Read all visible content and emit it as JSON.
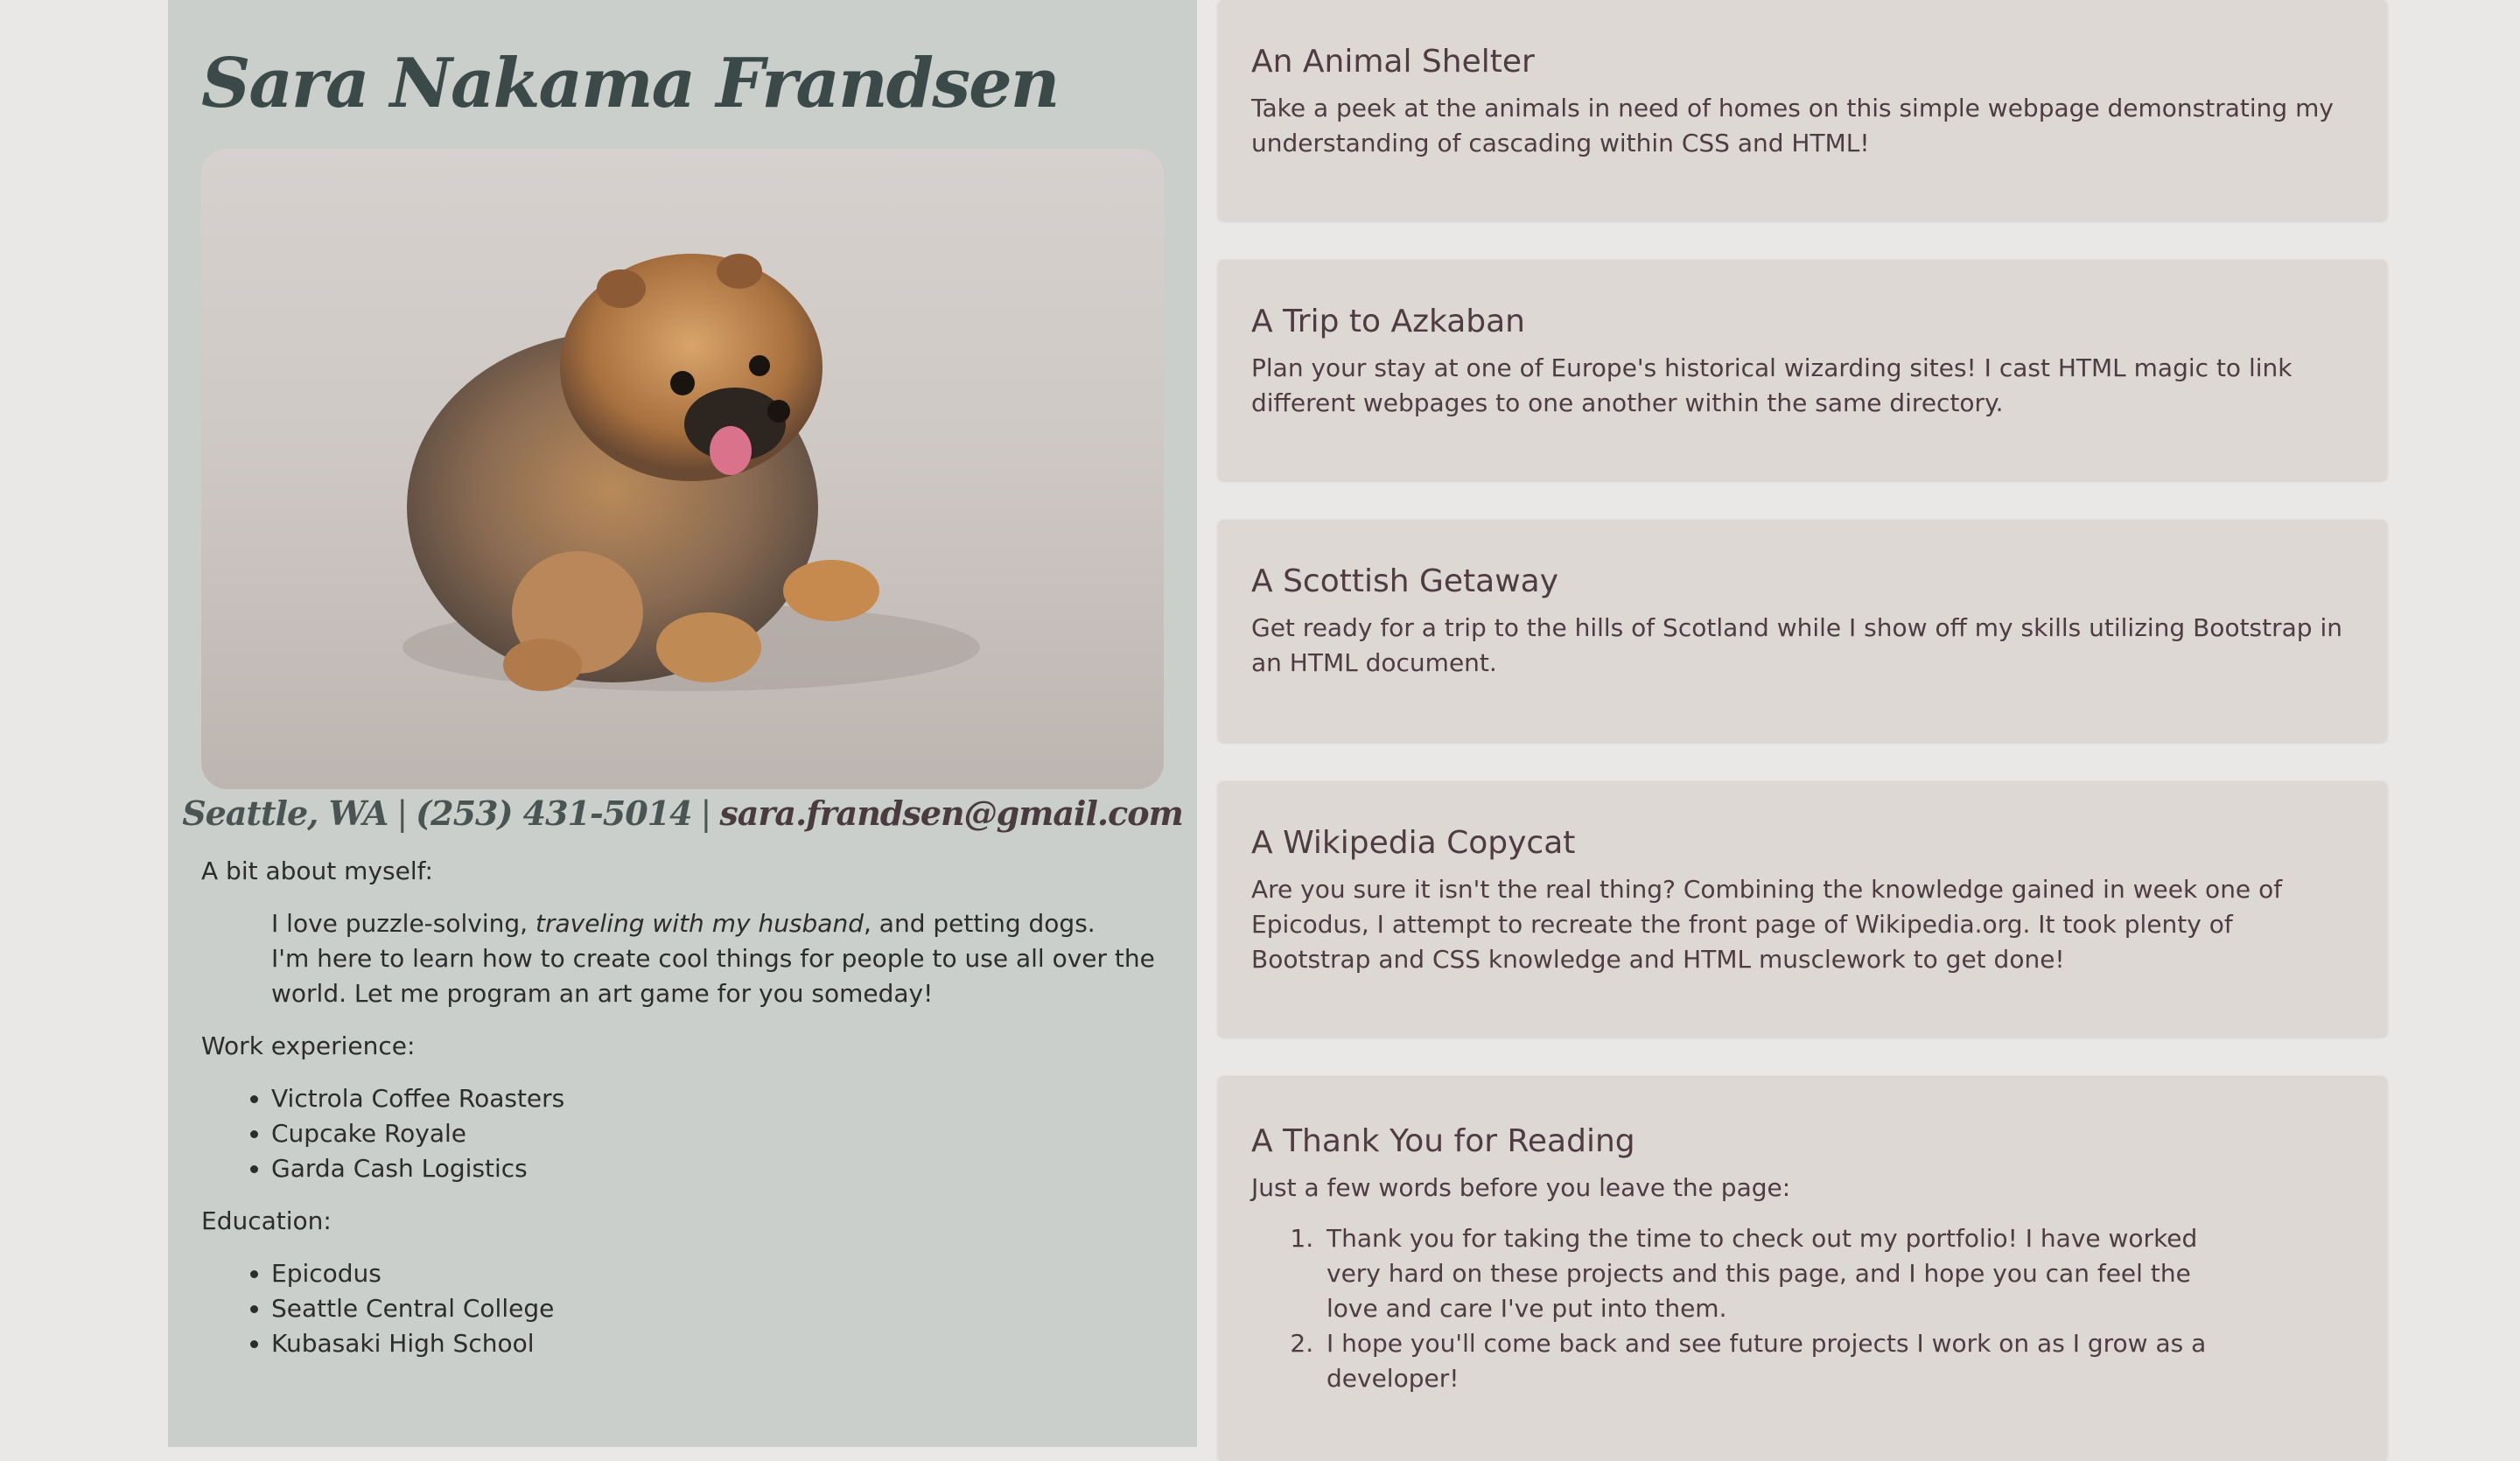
{
  "profile": {
    "name": "Sara Nakama Frandsen",
    "photo_alt": "Fluffy Pomeranian puppy running",
    "contact": {
      "location": "Seattle, WA",
      "separator": "|",
      "phone": "(253) 431-5014",
      "email": "sara.frandsen@gmail.com"
    },
    "about_label": "A bit about myself:",
    "about": {
      "before": "I love puzzle-solving, ",
      "emphasis": "traveling with my husband",
      "after": ", and petting dogs.",
      "line2": "I'm here to learn how to create cool things for people to use all over the world. Let me program an art game for you someday!"
    },
    "work_label": "Work experience:",
    "work": [
      "Victrola Coffee Roasters",
      "Cupcake Royale",
      "Garda Cash Logistics"
    ],
    "education_label": "Education:",
    "education": [
      "Epicodus",
      "Seattle Central College",
      "Kubasaki High School"
    ]
  },
  "projects": [
    {
      "title": "An Animal Shelter",
      "description": "Take a peek at the animals in need of homes on this simple webpage demonstrating my understanding of cascading within CSS and HTML!"
    },
    {
      "title": "A Trip to Azkaban",
      "description": "Plan your stay at one of Europe's historical wizarding sites! I cast HTML magic to link different webpages to one another within the same directory."
    },
    {
      "title": "A Scottish Getaway",
      "description": "Get ready for a trip to the hills of Scotland while I show off my skills utilizing Bootstrap in an HTML document."
    },
    {
      "title": "A Wikipedia Copycat",
      "description": "Are you sure it isn't the real thing? Combining the knowledge gained in week one of Epicodus, I attempt to recreate the front page of Wikipedia.org. It took plenty of Bootstrap and CSS knowledge and HTML musclework to get done!"
    }
  ],
  "thank_you": {
    "title": "A Thank You for Reading",
    "intro": "Just a few words before you leave the page:",
    "items": [
      "Thank you for taking the time to check out my portfolio! I have worked very hard on these projects and this page, and I hope you can feel the love and care I've put into them.",
      "I hope you'll come back and see future projects I work on as I grow as a developer!"
    ]
  }
}
